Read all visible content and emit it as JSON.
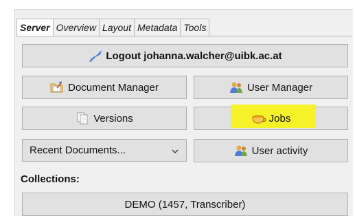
{
  "tabs": [
    {
      "label": "Server",
      "active": true
    },
    {
      "label": "Overview",
      "active": false
    },
    {
      "label": "Layout",
      "active": false
    },
    {
      "label": "Metadata",
      "active": false
    },
    {
      "label": "Tools",
      "active": false
    }
  ],
  "logout": {
    "label": "Logout johanna.walcher@uibk.ac.at",
    "icon": "satellite-icon"
  },
  "document_manager": {
    "label": "Document Manager",
    "icon": "folder-edit-icon"
  },
  "user_manager": {
    "label": "User Manager",
    "icon": "users-icon"
  },
  "versions": {
    "label": "Versions",
    "icon": "copy-icon"
  },
  "jobs": {
    "label": "Jobs",
    "icon": "cup-icon",
    "highlight_color": "#f5f22a"
  },
  "recent_documents": {
    "label": "Recent Documents...",
    "icon": "chevron-down-icon"
  },
  "user_activity": {
    "label": "User activity",
    "icon": "users-activity-icon"
  },
  "collections": {
    "heading": "Collections:",
    "selected": "DEMO (1457, Transcriber)"
  }
}
